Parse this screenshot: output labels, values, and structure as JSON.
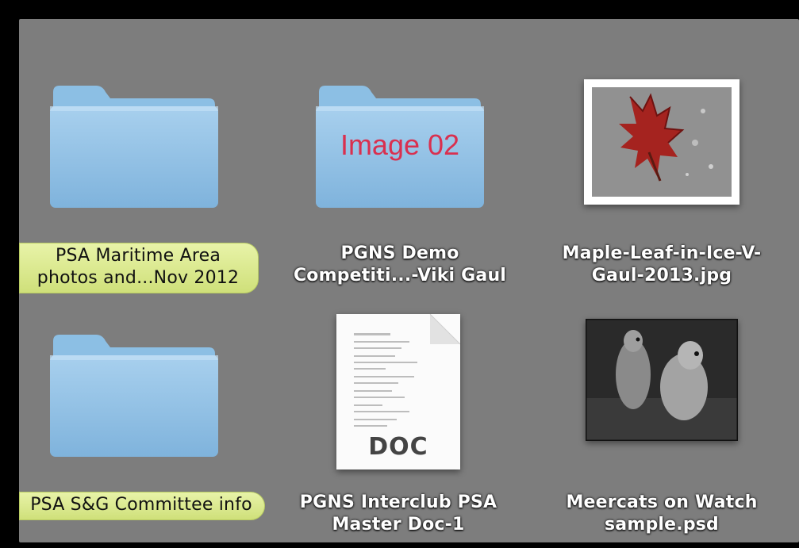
{
  "window": {
    "title": ""
  },
  "items": [
    {
      "kind": "folder",
      "label_lines": [
        "PSA Maritime Area",
        "photos and...Nov 2012"
      ],
      "tagged": true,
      "tag_color": "#d6e68a"
    },
    {
      "kind": "folder",
      "folder_text": "Image 02",
      "label_lines": [
        "PGNS Demo",
        "Competiti...-Viki Gaul"
      ],
      "tagged": false
    },
    {
      "kind": "image",
      "icon": "maple-leaf-photo-thumbnail",
      "label_lines": [
        "Maple-Leaf-in-Ice-V-",
        "Gaul-2013.jpg"
      ],
      "tagged": false
    },
    {
      "kind": "folder",
      "label_lines": [
        "PSA S&G Committee info"
      ],
      "tagged": true,
      "tag_color": "#d6e68a"
    },
    {
      "kind": "document",
      "doc_type": "DOC",
      "label_lines": [
        "PGNS Interclub PSA",
        "Master Doc-1"
      ],
      "tagged": false
    },
    {
      "kind": "image",
      "icon": "meerkats-photo-thumbnail",
      "label_lines": [
        "Meercats on Watch",
        "sample.psd"
      ],
      "tagged": false
    }
  ],
  "colors": {
    "background": "#7d7d7d",
    "folder_blue": "#8fc1e6",
    "tag_green": "#d6e68a",
    "folder_text": "#d9304f"
  }
}
